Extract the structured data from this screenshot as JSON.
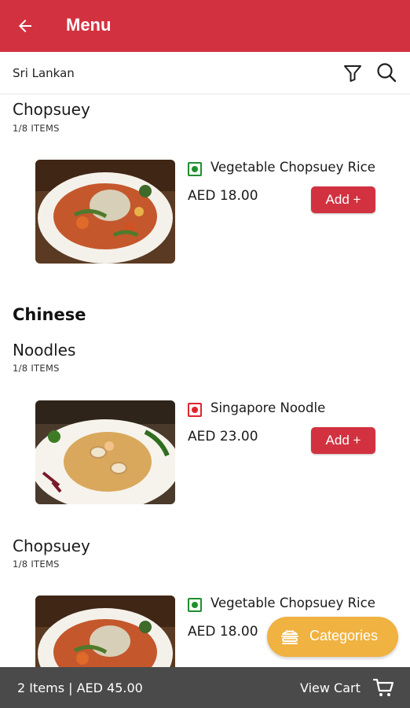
{
  "appbar": {
    "title": "Menu",
    "back_icon": "arrow-left-icon",
    "background": "#d2323f"
  },
  "filterbar": {
    "cuisine": "Sri Lankan",
    "filter_icon": "filter-icon",
    "search_icon": "search-icon"
  },
  "sections": [
    {
      "title": "Chopsuey",
      "count": "1/8 ITEMS",
      "item": {
        "name": "Vegetable Chopsuey Rice",
        "price": "AED 18.00",
        "add_label": "Add +",
        "diet": "veg"
      }
    },
    {
      "group": "Chinese",
      "title": "Noodles",
      "count": "1/8 ITEMS",
      "item": {
        "name": "Singapore Noodle",
        "price": "AED 23.00",
        "add_label": "Add +",
        "diet": "non-veg"
      }
    },
    {
      "title": "Chopsuey",
      "count": "1/8 ITEMS",
      "item": {
        "name": "Vegetable Chopsuey Rice",
        "price": "AED 18.00",
        "add_label": "Add +",
        "diet": "veg"
      }
    }
  ],
  "fab": {
    "label": "Categories",
    "icon": "food-categories-icon",
    "color": "#f0b240"
  },
  "cartbar": {
    "summary": "2 Items | AED 45.00",
    "view_cart": "View Cart",
    "icon": "cart-icon"
  },
  "colors": {
    "veg": "#1f8f2e",
    "nonveg": "#e0242f"
  }
}
